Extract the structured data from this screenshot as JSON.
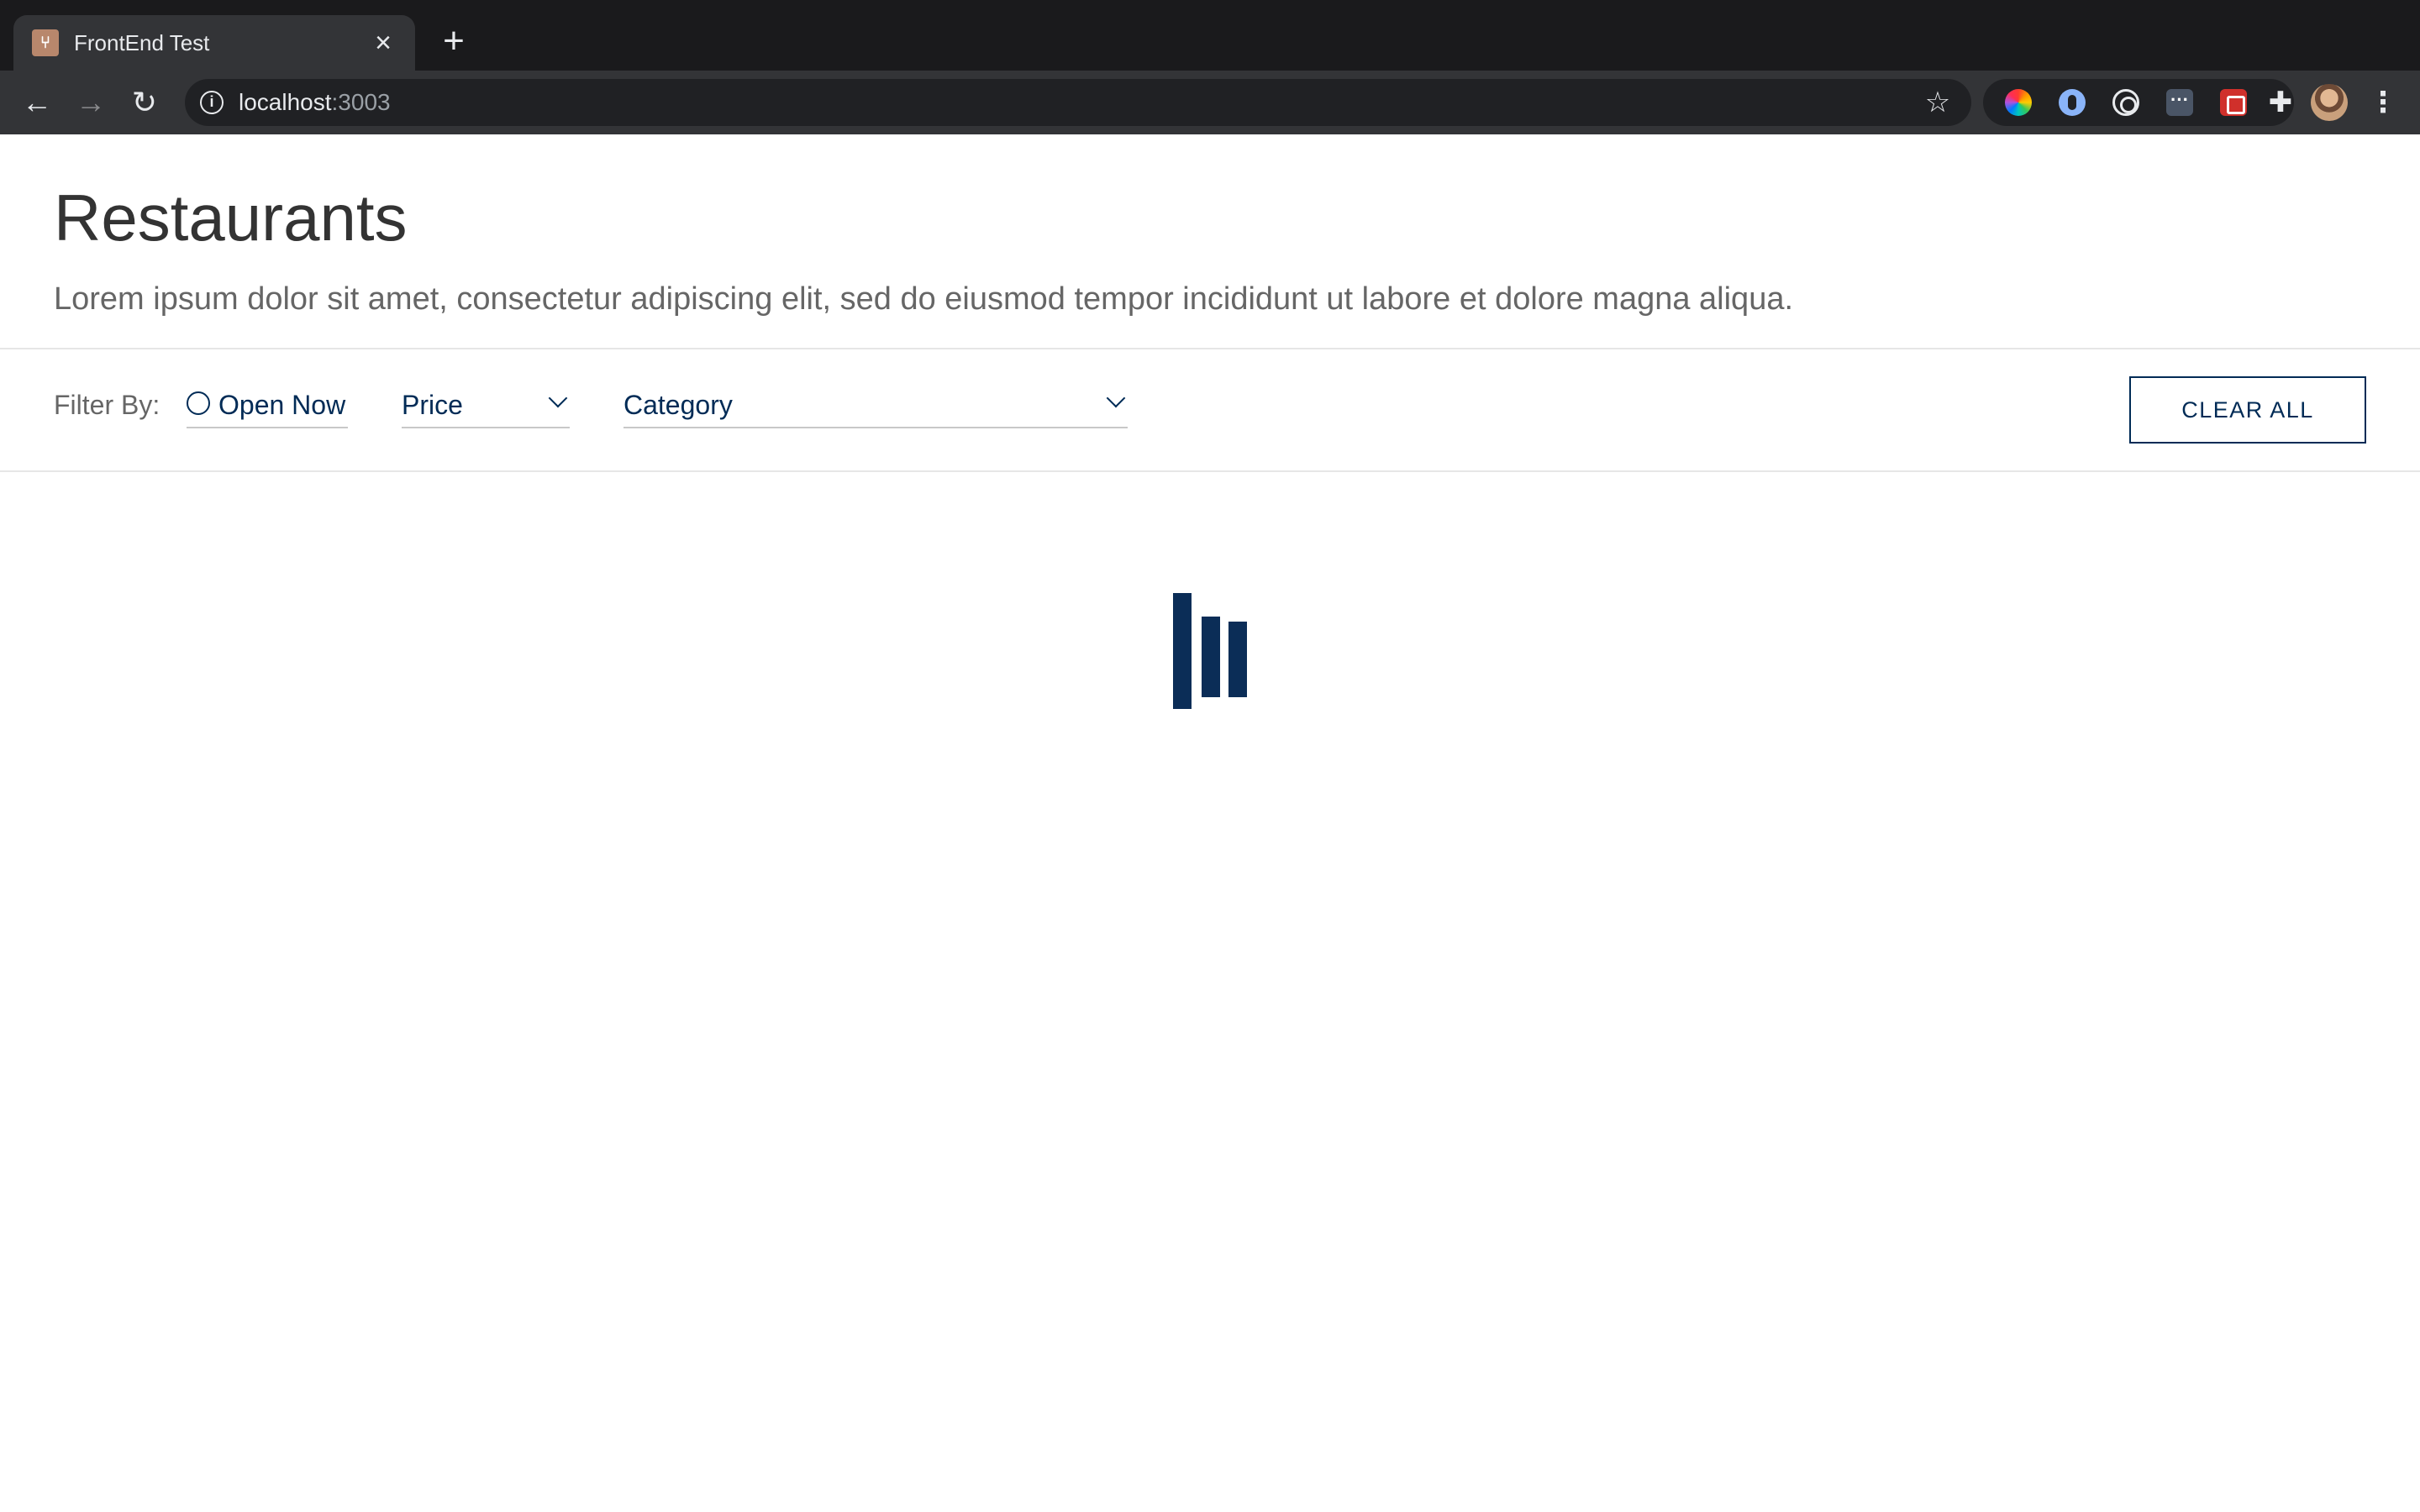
{
  "browser": {
    "tab_title": "FrontEnd Test",
    "tab_favicon": "fork-knife-icon",
    "url_host": "localhost",
    "url_port": ":3003",
    "icons": {
      "back": "←",
      "forward": "→",
      "reload": "↻",
      "close": "×",
      "new_tab": "+",
      "info": "i",
      "star": "☆",
      "puzzle": "✚",
      "menu": "⋮",
      "ext_dots": "···"
    }
  },
  "header": {
    "title": "Restaurants",
    "subtitle": "Lorem ipsum dolor sit amet, consectetur adipiscing elit, sed do eiusmod tempor incididunt ut labore et dolore magna aliqua."
  },
  "filters": {
    "label": "Filter By:",
    "open_now": "Open Now",
    "price": "Price",
    "category": "Category",
    "clear_all": "CLEAR ALL"
  },
  "colors": {
    "primary": "#002b56",
    "loader": "#0b2d57",
    "text_dark": "#333333",
    "text_muted": "#666666"
  }
}
